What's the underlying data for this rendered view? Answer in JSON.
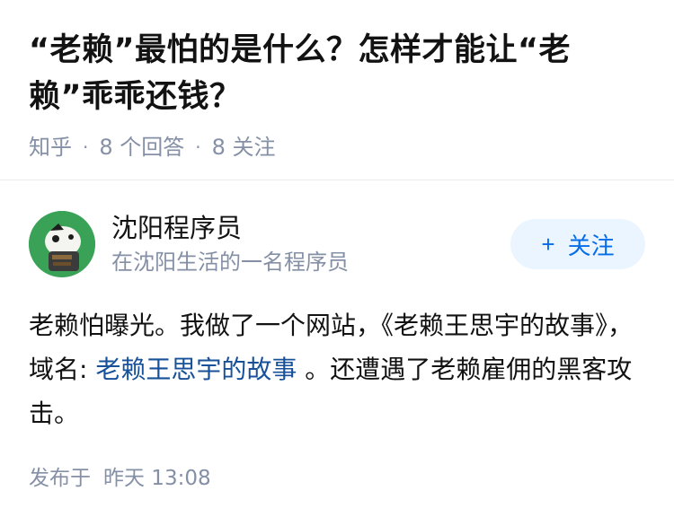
{
  "question": {
    "title": "“老赖”最怕的是什么？怎样才能让“老赖”乖乖还钱？",
    "source": "知乎",
    "answers_count": "8 个回答",
    "followers_count": "8 关注"
  },
  "author": {
    "name": "沈阳程序员",
    "bio": "在沈阳生活的一名程序员",
    "follow_label": "关注",
    "follow_icon": "plus-icon",
    "avatar_color": "#3aa257"
  },
  "answer": {
    "text_before": "老赖怕曝光。我做了一个网站，《老赖王思宇的故事》， 域名: ",
    "link_text": "老赖王思宇的故事",
    "text_after": " 。还遭遇了老赖雇佣的黑客攻击。",
    "published_label": "发布于",
    "published_time": "昨天 13:08"
  },
  "colors": {
    "link": "#175199",
    "follow_text": "#056de8",
    "follow_bg": "#ebf5ff",
    "meta": "#8590a6"
  }
}
